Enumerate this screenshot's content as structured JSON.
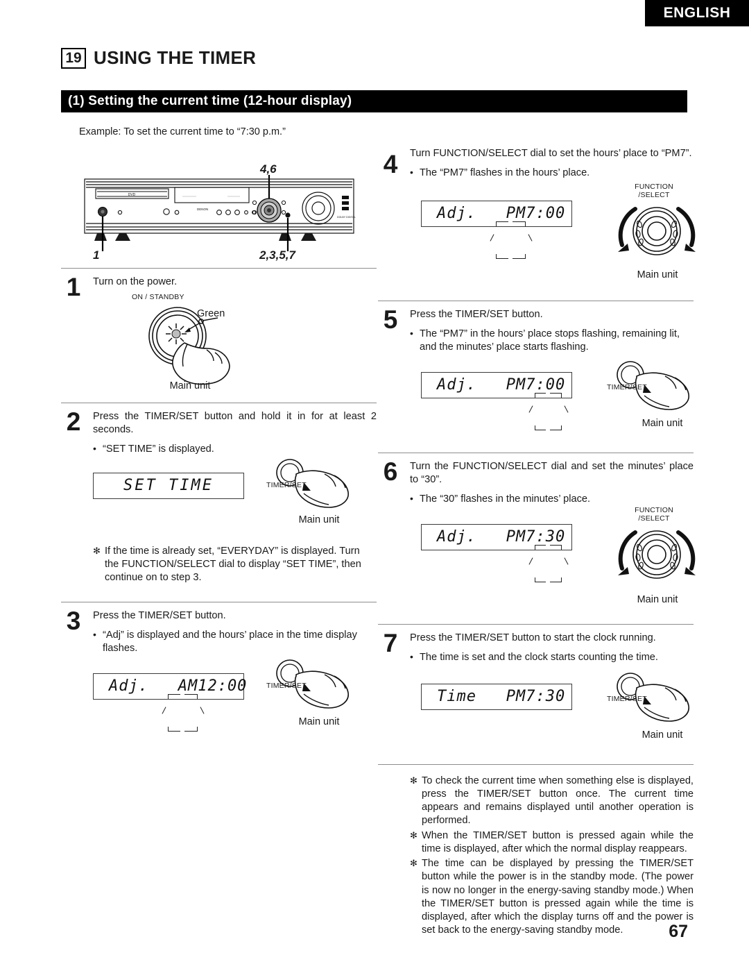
{
  "header": {
    "language_tab": "ENGLISH",
    "chapter_number": "19",
    "chapter_title": "USING THE TIMER",
    "section_title": "(1) Setting the current time (12-hour display)",
    "example": "Example:  To set the current time to “7:30 p.m.”"
  },
  "device_diagram": {
    "brand": "DENON",
    "disc_label": "DVD",
    "callout_top": "4,6",
    "callout_bottom_left": "1",
    "callout_bottom_right": "2,3,5,7"
  },
  "steps": [
    {
      "number": "1",
      "text": "Turn on the power.",
      "bullets": [],
      "illustration": {
        "kind": "power-button",
        "label_top": "ON / STANDBY",
        "label_side": "Green",
        "caption": "Main unit"
      },
      "lcd": null,
      "notes": []
    },
    {
      "number": "2",
      "text": "Press the TIMER/SET button and hold it in for at least 2 seconds.",
      "bullets": [
        "“SET TIME” is displayed."
      ],
      "illustration": {
        "kind": "timer-set-button",
        "label_side": "TIMER/SET",
        "caption": "Main unit"
      },
      "lcd": {
        "text": "SET TIME",
        "align": "center"
      },
      "notes": [
        "If the time is already set, “EVERYDAY” is displayed. Turn the FUNCTION/SELECT dial to display “SET TIME”, then continue on to step 3."
      ]
    },
    {
      "number": "3",
      "text": "Press the TIMER/SET button.",
      "bullets": [
        "“Adj” is displayed and the hours’ place in the time display flashes."
      ],
      "illustration": {
        "kind": "timer-set-button",
        "label_side": "TIMER/SET",
        "caption": "Main unit"
      },
      "lcd": {
        "text": "Adj.   AM12:00",
        "flash": "hours"
      },
      "notes": []
    },
    {
      "number": "4",
      "text": "Turn FUNCTION/SELECT dial to set the hours’ place to “PM7”.",
      "bullets": [
        "The “PM7” flashes in the hours’ place."
      ],
      "illustration": {
        "kind": "function-select-dial",
        "label_top": "FUNCTION\n/SELECT",
        "caption": "Main unit"
      },
      "lcd": {
        "text": "Adj.   PM7:00",
        "flash": "hours"
      },
      "notes": []
    },
    {
      "number": "5",
      "text": "Press the TIMER/SET button.",
      "bullets": [
        "The “PM7” in the hours’ place stops flashing, remaining lit, and the minutes’ place starts flashing."
      ],
      "illustration": {
        "kind": "timer-set-button",
        "label_side": "TIMER/SET",
        "caption": "Main unit"
      },
      "lcd": {
        "text": "Adj.   PM7:00",
        "flash": "minutes"
      },
      "notes": []
    },
    {
      "number": "6",
      "text": "Turn the FUNCTION/SELECT dial and set the minutes’ place to “30”.",
      "bullets": [
        "The “30” flashes in the minutes’ place."
      ],
      "illustration": {
        "kind": "function-select-dial",
        "label_top": "FUNCTION\n/SELECT",
        "caption": "Main unit"
      },
      "lcd": {
        "text": "Adj.   PM7:30",
        "flash": "minutes"
      },
      "notes": []
    },
    {
      "number": "7",
      "text": "Press the TIMER/SET button to start the clock running.",
      "bullets": [
        "The time is set and the clock starts counting the time."
      ],
      "illustration": {
        "kind": "timer-set-button",
        "label_side": "TIMER/SET",
        "caption": "Main unit"
      },
      "lcd": {
        "text": "Time   PM7:30"
      },
      "notes": []
    }
  ],
  "footnotes": [
    "To check the current time when something else is displayed, press the TIMER/SET button once.  The current time appears and remains displayed until another operation is performed.",
    "When the TIMER/SET button is pressed again while the time is displayed, after which the normal display reappears.",
    "The time can be displayed by pressing the TIMER/SET button while the power is in the standby mode.  (The power is now no longer in the energy-saving standby mode.)  When the TIMER/SET button is pressed again while the time is displayed, after which the display turns off and the power is set back to the energy-saving standby mode."
  ],
  "page_number": "67"
}
